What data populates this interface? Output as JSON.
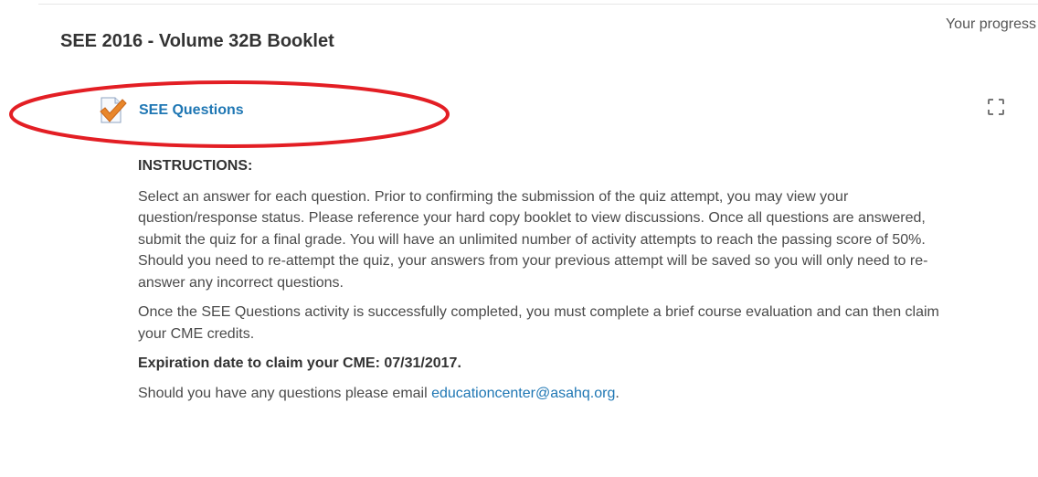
{
  "header": {
    "progress_label": "Your progress"
  },
  "section": {
    "title": "SEE 2016 - Volume 32B Booklet"
  },
  "activity": {
    "name": "SEE Questions",
    "icon": "quiz-checkmark-icon",
    "completion_icon": "completion-checkbox-icon",
    "annotation_color": "#e31e24"
  },
  "description": {
    "heading": "INSTRUCTIONS:",
    "paragraph1": "Select an answer for each question. Prior to confirming the submission of the quiz attempt, you may view your question/response status. Please reference your hard copy booklet to view discussions. Once all questions are answered, submit the quiz for a final grade. You will have an unlimited number of activity attempts to reach the passing score of 50%. Should you need to re-attempt the quiz, your answers from your previous attempt will be saved so you will only need to re-answer any incorrect questions.",
    "paragraph2": "Once the SEE Questions activity is successfully completed, you must complete a brief course evaluation and can then claim your CME credits.",
    "expiration": "Expiration date to claim your CME: 07/31/2017.",
    "contact_prefix": "Should you have any questions please email ",
    "contact_email": "educationcenter@asahq.org",
    "contact_suffix": "."
  },
  "colors": {
    "link": "#1f77b4",
    "text": "#4a4a4a",
    "heading": "#333333"
  }
}
